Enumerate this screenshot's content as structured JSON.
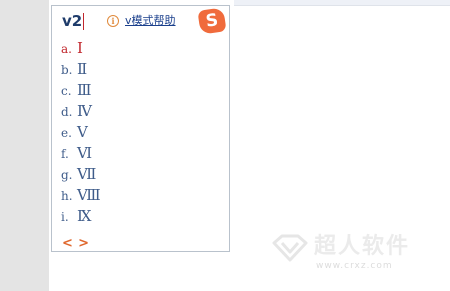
{
  "composition": {
    "text": "v2"
  },
  "help": {
    "icon": "info-icon",
    "label": "v模式帮助"
  },
  "logo": {
    "icon": "sogou-logo",
    "glyph": "S",
    "color": "#f06b3c"
  },
  "candidates": [
    {
      "index": "a.",
      "value": "Ⅰ",
      "selected": true
    },
    {
      "index": "b.",
      "value": "Ⅱ",
      "selected": false
    },
    {
      "index": "c.",
      "value": "Ⅲ",
      "selected": false
    },
    {
      "index": "d.",
      "value": "Ⅳ",
      "selected": false
    },
    {
      "index": "e.",
      "value": "Ⅴ",
      "selected": false
    },
    {
      "index": "f.",
      "value": "Ⅵ",
      "selected": false
    },
    {
      "index": "g.",
      "value": "Ⅶ",
      "selected": false
    },
    {
      "index": "h.",
      "value": "Ⅷ",
      "selected": false
    },
    {
      "index": "i.",
      "value": "Ⅸ",
      "selected": false
    }
  ],
  "pager": {
    "prev": "<",
    "next": ">"
  },
  "watermark": {
    "name": "超人软件",
    "url": "www.crxz.com"
  },
  "colors": {
    "selected": "#c1272d",
    "candidate": "#3f5c8a",
    "pager": "#e0682e",
    "link": "#1a3f8c",
    "border": "#b9c2cc"
  }
}
